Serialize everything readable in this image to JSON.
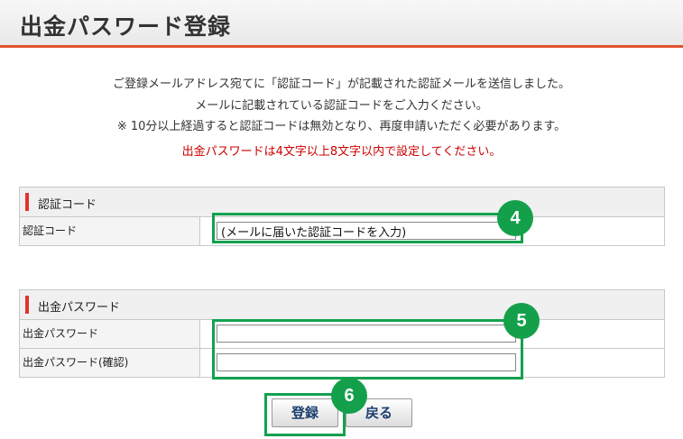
{
  "page_title": "出金パスワード登録",
  "instructions": [
    "ご登録メールアドレス宛てに「認証コード」が記載された認証メールを送信しました。",
    "メールに記載されている認証コードをご入力ください。",
    "※ 10分以上経過すると認証コードは無効となり、再度申請いただく必要があります。"
  ],
  "warning": "出金パスワードは4文字以上8文字以内で設定してください。",
  "auth_section": {
    "title": "認証コード",
    "label": "認証コード",
    "value": "(メールに届いた認証コードを入力)"
  },
  "password_section": {
    "title": "出金パスワード",
    "password_label": "出金パスワード",
    "password_value": "",
    "confirm_label": "出金パスワード(確認)",
    "confirm_value": ""
  },
  "buttons": {
    "register": "登録",
    "back": "戻る"
  },
  "step_badges": {
    "auth": "4",
    "password": "5",
    "register": "6"
  },
  "colors": {
    "accent_red": "#e4312b",
    "header_line": "#e0532e",
    "highlight_green": "#14a04a",
    "warning_text": "#cc0000"
  }
}
